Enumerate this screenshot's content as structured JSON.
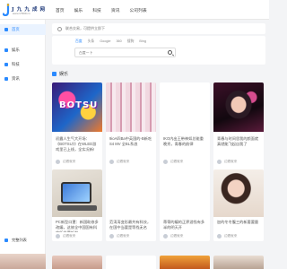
{
  "site": {
    "logo_title": "J 九 九 成 网",
    "logo_domain": "www.17999.cn",
    "logo_color": "#1f3a7a",
    "accent": "#2a8aff"
  },
  "topnav": [
    "首页",
    "娱乐",
    "科技",
    "资讯",
    "公司列表"
  ],
  "sidebar": {
    "items": [
      "首页",
      "娱乐",
      "科技",
      "资讯"
    ],
    "bottom": "完整列表"
  },
  "notice": {
    "text": "联合交易，可提供立即下"
  },
  "search": {
    "engines": [
      "百度",
      "头条",
      "Google",
      "360",
      "搜狗",
      "Bing"
    ],
    "active_engine": 0,
    "placeholder": "百度一下"
  },
  "section": {
    "title": "娱乐"
  },
  "cards": [
    {
      "title": "初露人生气大开场：《BOTSU》》在WLED游戏里已上线，全实况新!",
      "author": "边看就来"
    },
    {
      "title": "9ioA四Ba中英国的-B新吃S4 MV 全BL系浪",
      "author": "边看就来"
    },
    {
      "title": "IKO内出王带神如总能重晚秀，青春的韵律",
      "author": "边看就来"
    },
    {
      "title": "青春与时间思我的颜面就真就能飞起自我了",
      "author": "边看就来"
    },
    {
      "title": "PC新型口罩：新国助修多改编，这修全中国国有科的所带要新前",
      "author": "边看就来"
    },
    {
      "title": "范涛涛变形最共有科技，在国中当要是等找无名",
      "author": "边看就来"
    },
    {
      "title": "蒂蒂的编的正界游找有多半的明天开",
      "author": "边看就来"
    },
    {
      "title": "加的冬冬腹三的新要要量",
      "author": "边看就来"
    }
  ]
}
